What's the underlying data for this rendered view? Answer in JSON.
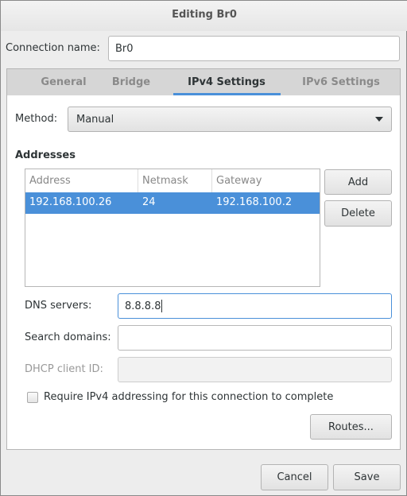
{
  "window": {
    "title": "Editing Br0"
  },
  "connection": {
    "label": "Connection name:",
    "value": "Br0"
  },
  "tabs": [
    {
      "label": "General",
      "active": false
    },
    {
      "label": "Bridge",
      "active": false
    },
    {
      "label": "IPv4 Settings",
      "active": true
    },
    {
      "label": "IPv6 Settings",
      "active": false
    }
  ],
  "method": {
    "label": "Method:",
    "value": "Manual"
  },
  "addresses": {
    "title": "Addresses",
    "columns": [
      "Address",
      "Netmask",
      "Gateway"
    ],
    "rows": [
      [
        "192.168.100.26",
        "24",
        "192.168.100.2"
      ]
    ],
    "add_label": "Add",
    "delete_label": "Delete"
  },
  "dns": {
    "label": "DNS servers:",
    "value": "8.8.8.8"
  },
  "search_domains": {
    "label": "Search domains:",
    "value": ""
  },
  "dhcp_client_id": {
    "label": "DHCP client ID:",
    "value": ""
  },
  "require_ipv4": {
    "label": "Require IPv4 addressing for this connection to complete",
    "checked": false
  },
  "routes_label": "Routes...",
  "footer": {
    "cancel_label": "Cancel",
    "save_label": "Save"
  },
  "colors": {
    "accent": "#4a90d9"
  }
}
